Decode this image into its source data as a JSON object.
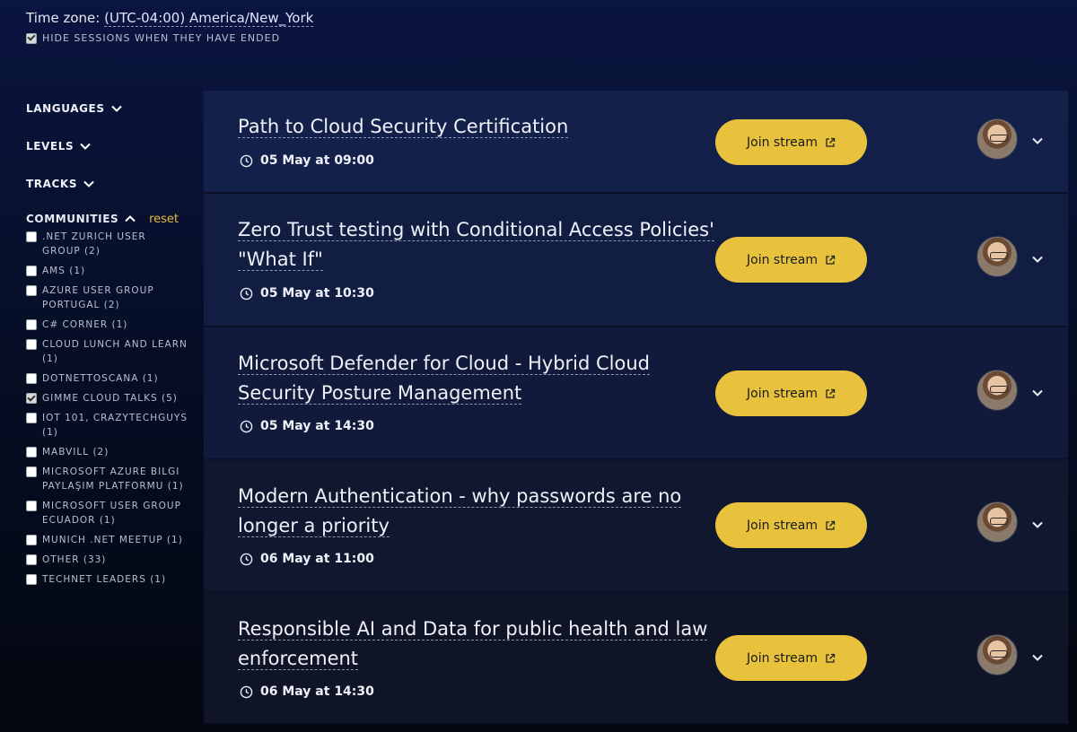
{
  "timezone": {
    "label": "Time zone:",
    "value": "(UTC-04:00) America/New_York"
  },
  "hide_ended": {
    "label": "HIDE SESSIONS WHEN THEY HAVE ENDED",
    "checked": true
  },
  "filters": {
    "languages": "LANGUAGES",
    "levels": "LEVELS",
    "tracks": "TRACKS",
    "communities": "COMMUNITIES",
    "reset": "reset"
  },
  "communities": [
    {
      "label": ".NET ZURICH USER GROUP (2)",
      "checked": false
    },
    {
      "label": "AMS (1)",
      "checked": false
    },
    {
      "label": "AZURE USER GROUP PORTUGAL (2)",
      "checked": false
    },
    {
      "label": "C# CORNER (1)",
      "checked": false
    },
    {
      "label": "CLOUD LUNCH AND LEARN (1)",
      "checked": false
    },
    {
      "label": "DOTNETTOSCANA (1)",
      "checked": false
    },
    {
      "label": "GIMME CLOUD TALKS (5)",
      "checked": true
    },
    {
      "label": "IOT 101, CRAZYTECHGUYS (1)",
      "checked": false
    },
    {
      "label": "MABVILL (2)",
      "checked": false
    },
    {
      "label": "MICROSOFT AZURE BILGI PAYLAŞIM PLATFORMU (1)",
      "checked": false
    },
    {
      "label": "MICROSOFT USER GROUP ECUADOR (1)",
      "checked": false
    },
    {
      "label": "MUNICH .NET MEETUP (1)",
      "checked": false
    },
    {
      "label": "OTHER (33)",
      "checked": false
    },
    {
      "label": "TECHNET LEADERS (1)",
      "checked": false
    }
  ],
  "sessions": [
    {
      "title": "Path to Cloud Security Certification",
      "time": "05 May at 09:00",
      "join": "Join stream"
    },
    {
      "title": "Zero Trust testing with Conditional Access Policies' \"What If\"",
      "time": "05 May at 10:30",
      "join": "Join stream"
    },
    {
      "title": "Microsoft Defender for Cloud - Hybrid Cloud Security Posture Management",
      "time": "05 May at 14:30",
      "join": "Join stream"
    },
    {
      "title": "Modern Authentication - why passwords are no longer a priority",
      "time": "06 May at 11:00",
      "join": "Join stream"
    },
    {
      "title": "Responsible AI and Data for public health and law enforcement",
      "time": "06 May at 14:30",
      "join": "Join stream"
    }
  ],
  "colors": {
    "accent": "#e8c23c",
    "background": "#0a1540"
  }
}
